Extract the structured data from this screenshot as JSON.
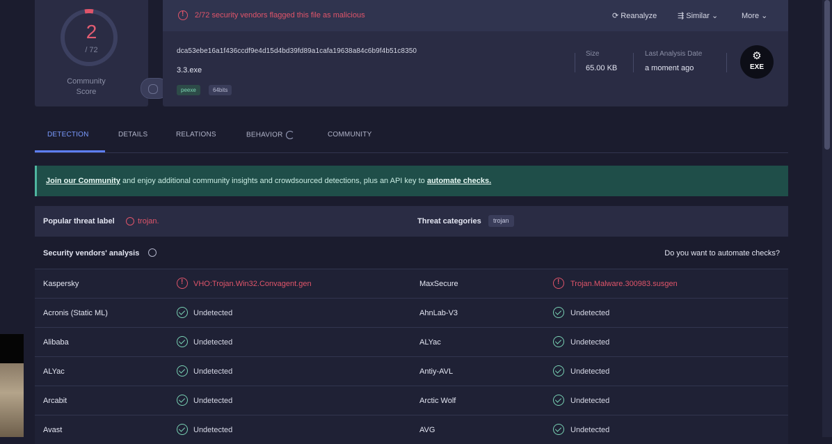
{
  "score": {
    "detections": "2",
    "total": "/ 72",
    "community_label_1": "Community",
    "community_label_2": "Score"
  },
  "header": {
    "flag_text": "2/72 security vendors flagged this file as malicious",
    "reanalyze": "Reanalyze",
    "similar": "Similar",
    "more": "More",
    "hash": "dca53ebe16a1f436ccdf9e4d15d4bd39fd89a1cafa19638a84c6b9f4b51c8350",
    "filename": "3.3.exe",
    "tags": [
      "peexe",
      "64bits"
    ],
    "size_label": "Size",
    "size_value": "65.00 KB",
    "date_label": "Last Analysis Date",
    "date_value": "a moment ago",
    "file_type": "EXE"
  },
  "tabs": [
    "DETECTION",
    "DETAILS",
    "RELATIONS",
    "BEHAVIOR",
    "COMMUNITY"
  ],
  "banner": {
    "link1": "Join our Community",
    "middle": " and enjoy additional community insights and crowdsourced detections, plus an API key to ",
    "link2": "automate checks."
  },
  "threat": {
    "popular_label": "Popular threat label",
    "popular_value": "trojan.",
    "categories_label": "Threat categories",
    "category": "trojan"
  },
  "vendors": {
    "title": "Security vendors' analysis",
    "automate": "Do you want to automate checks?",
    "rows": [
      {
        "left_name": "Kaspersky",
        "left_result": "VHO:Trojan.Win32.Convagent.gen",
        "left_status": "bad",
        "right_name": "MaxSecure",
        "right_result": "Trojan.Malware.300983.susgen",
        "right_status": "bad"
      },
      {
        "left_name": "Acronis (Static ML)",
        "left_result": "Undetected",
        "left_status": "ok",
        "right_name": "AhnLab-V3",
        "right_result": "Undetected",
        "right_status": "ok"
      },
      {
        "left_name": "Alibaba",
        "left_result": "Undetected",
        "left_status": "ok",
        "right_name": "ALYac",
        "right_result": "Undetected",
        "right_status": "ok"
      },
      {
        "left_name": "ALYac",
        "left_result": "Undetected",
        "left_status": "ok",
        "right_name": "Antiy-AVL",
        "right_result": "Undetected",
        "right_status": "ok"
      },
      {
        "left_name": "Arcabit",
        "left_result": "Undetected",
        "left_status": "ok",
        "right_name": "Arctic Wolf",
        "right_result": "Undetected",
        "right_status": "ok"
      },
      {
        "left_name": "Avast",
        "left_result": "Undetected",
        "left_status": "ok",
        "right_name": "AVG",
        "right_result": "Undetected",
        "right_status": "ok"
      }
    ]
  }
}
